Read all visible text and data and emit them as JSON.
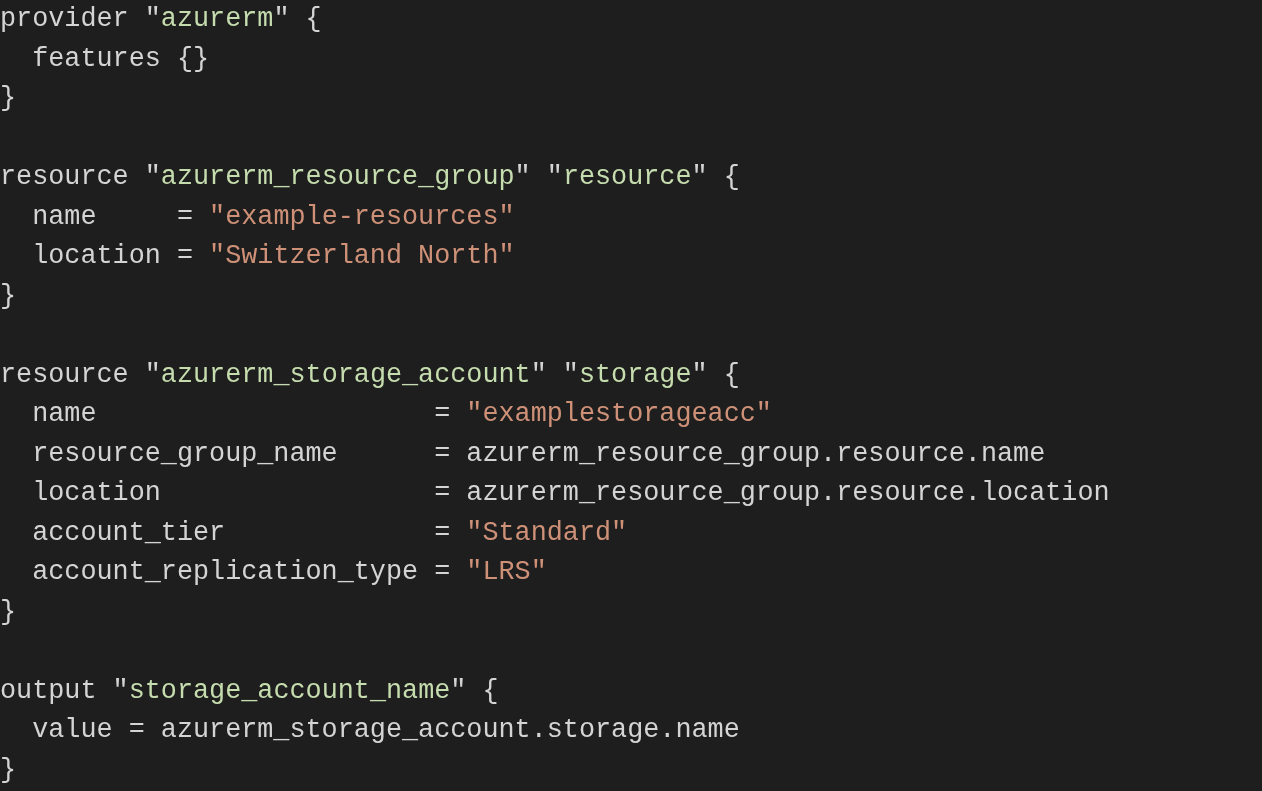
{
  "editor": {
    "blocks": [
      {
        "lines": [
          [
            {
              "kind": "text",
              "text": "provider "
            },
            {
              "kind": "label",
              "text": "\"azurerm\""
            },
            {
              "kind": "text",
              "text": " {"
            }
          ],
          [
            {
              "kind": "text",
              "text": "  features {}"
            }
          ],
          [
            {
              "kind": "text",
              "text": "}"
            }
          ]
        ]
      },
      {
        "lines": [
          [
            {
              "kind": "text",
              "text": "resource "
            },
            {
              "kind": "label",
              "text": "\"azurerm_resource_group\""
            },
            {
              "kind": "label",
              "text": "\"resource\""
            },
            {
              "kind": "text",
              "text": " {"
            }
          ],
          [
            {
              "kind": "text",
              "text": "  name     = "
            },
            {
              "kind": "string",
              "text": "\"example-resources\""
            }
          ],
          [
            {
              "kind": "text",
              "text": "  location = "
            },
            {
              "kind": "string",
              "text": "\"Switzerland North\""
            }
          ],
          [
            {
              "kind": "text",
              "text": "}"
            }
          ]
        ]
      },
      {
        "lines": [
          [
            {
              "kind": "text",
              "text": "resource "
            },
            {
              "kind": "label",
              "text": "\"azurerm_storage_account\""
            },
            {
              "kind": "label",
              "text": "\"storage\""
            },
            {
              "kind": "text",
              "text": " {"
            }
          ],
          [
            {
              "kind": "text",
              "text": "  name                     = "
            },
            {
              "kind": "string",
              "text": "\"examplestorageacc\""
            }
          ],
          [
            {
              "kind": "text",
              "text": "  resource_group_name      = azurerm_resource_group.resource.name"
            }
          ],
          [
            {
              "kind": "text",
              "text": "  location                 = azurerm_resource_group.resource.location"
            }
          ],
          [
            {
              "kind": "text",
              "text": "  account_tier             = "
            },
            {
              "kind": "string",
              "text": "\"Standard\""
            }
          ],
          [
            {
              "kind": "text",
              "text": "  account_replication_type = "
            },
            {
              "kind": "string",
              "text": "\"LRS\""
            }
          ],
          [
            {
              "kind": "text",
              "text": "}"
            }
          ]
        ]
      },
      {
        "lines": [
          [
            {
              "kind": "text",
              "text": "output "
            },
            {
              "kind": "label",
              "text": "\"storage_account_name\""
            },
            {
              "kind": "text",
              "text": " {"
            }
          ],
          [
            {
              "kind": "text",
              "text": "  value = azurerm_storage_account.storage.name"
            }
          ],
          [
            {
              "kind": "text",
              "text": "}"
            }
          ]
        ]
      }
    ]
  }
}
